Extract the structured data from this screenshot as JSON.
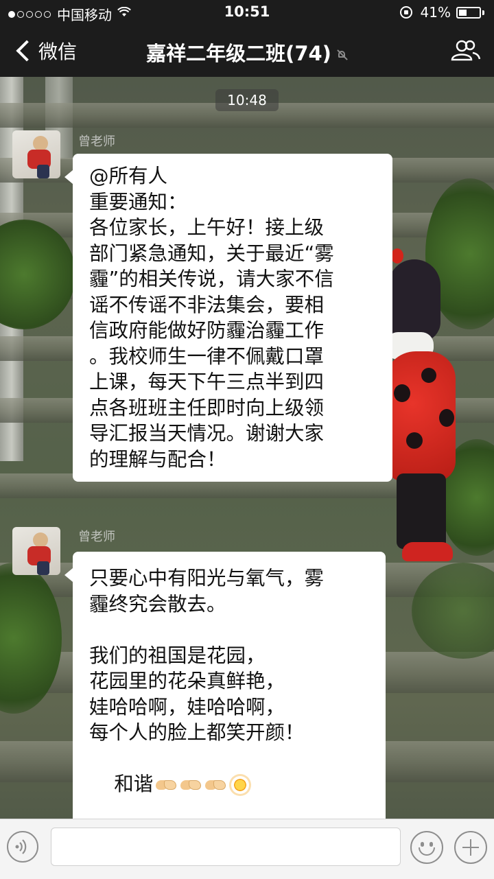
{
  "status_bar": {
    "signal_dots": 5,
    "signal_filled": 1,
    "carrier": "中国移动",
    "wifi_icon": "wifi-icon",
    "time": "10:51",
    "rotation_lock_icon": "rotation-lock-icon",
    "battery_percent": "41%",
    "battery_level": 0.41
  },
  "nav": {
    "back_label": "微信",
    "title": "嘉祥二年级二班(74)",
    "mute_icon": "mute-icon",
    "members_icon": "group-members-icon"
  },
  "chat": {
    "timestamp": "10:48",
    "messages": [
      {
        "sender": "曾老师",
        "lines": [
          "@所有人",
          "重要通知：",
          "各位家长，上午好！接上级",
          "部门紧急通知，关于最近“雾",
          "霾”的相关传说，请大家不信",
          "谣不传谣不非法集会，要相",
          "信政府能做好防霾治霾工作",
          "。我校师生一律不佩戴口罩",
          "上课，每天下午三点半到四",
          "点各班班主任即时向上级领",
          "导汇报当天情况。谢谢大家",
          "的理解与配合！"
        ]
      },
      {
        "sender": "曾老师",
        "lines": [
          "只要心中有阳光与氧气，雾",
          "霾终究会散去。",
          "",
          "我们的祖国是花园，",
          "花园里的花朵真鲜艳，",
          "娃哈哈啊，娃哈哈啊，",
          "每个人的脸上都笑开颜！"
        ],
        "last_line_text": "和谐",
        "last_line_emojis": [
          "handshake-icon",
          "handshake-icon",
          "handshake-icon",
          "sun-icon"
        ]
      }
    ]
  },
  "input_bar": {
    "voice_icon": "voice-icon",
    "text_value": "",
    "emoji_icon": "emoji-icon",
    "plus_icon": "plus-icon"
  }
}
